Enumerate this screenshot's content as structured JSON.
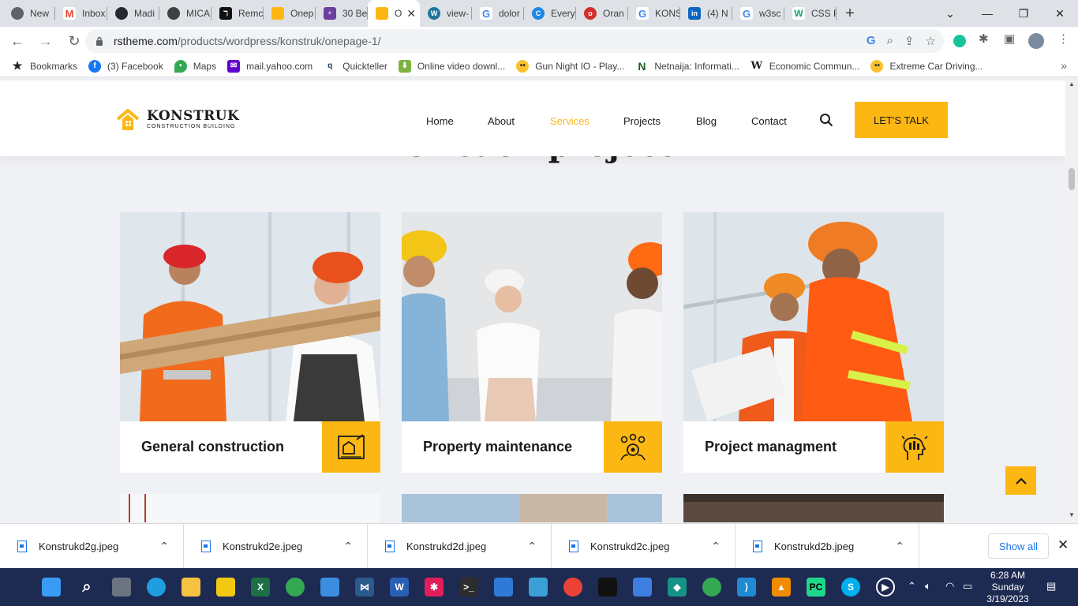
{
  "browser": {
    "tabs": [
      {
        "label": "New",
        "color": "#5f6368"
      },
      {
        "label": "Inbox",
        "color": "#ea4335"
      },
      {
        "label": "Madi",
        "color": "#24292f"
      },
      {
        "label": "MICA",
        "color": "#3c4043"
      },
      {
        "label": "Remc",
        "color": "#111111"
      },
      {
        "label": "Onep",
        "color": "#fdb713"
      },
      {
        "label": "30 Be",
        "color": "#6b3fa0"
      },
      {
        "label": "O",
        "color": "#fdb713",
        "active": true
      },
      {
        "label": "view-",
        "color": "#21759b"
      },
      {
        "label": "dolor",
        "color": "#4285f4"
      },
      {
        "label": "Every",
        "color": "#1e88e5"
      },
      {
        "label": "Oran",
        "color": "#d32f2f"
      },
      {
        "label": "KONS",
        "color": "#4285f4"
      },
      {
        "label": "(4) N",
        "color": "#0a66c2"
      },
      {
        "label": "w3sc",
        "color": "#4285f4"
      },
      {
        "label": "CSS F",
        "color": "#04aa6d"
      }
    ],
    "url_host": "rstheme.com",
    "url_path": "/products/wordpress/konstruk/onepage-1/",
    "bookmarks": [
      {
        "label": "Bookmarks",
        "color": "#202124"
      },
      {
        "label": "(3) Facebook",
        "color": "#1877f2"
      },
      {
        "label": "Maps",
        "color": "#34a853"
      },
      {
        "label": "mail.yahoo.com",
        "color": "#6001d2"
      },
      {
        "label": "Quickteller",
        "color": "#1b3a5c"
      },
      {
        "label": "Online video downl...",
        "color": "#7cb342"
      },
      {
        "label": "Gun Night IO - Play...",
        "color": "#fbc02d"
      },
      {
        "label": "Netnaija: Informati...",
        "color": "#1b5e20"
      },
      {
        "label": "Economic Commun...",
        "color": "#202124"
      },
      {
        "label": "Extreme Car Driving...",
        "color": "#fbc02d"
      }
    ]
  },
  "site": {
    "logo_name": "KONSTRUK",
    "logo_tag": "CONSTRUCTION BUILDING",
    "nav": [
      "Home",
      "About",
      "Services",
      "Projects",
      "Blog",
      "Contact"
    ],
    "nav_active": "Services",
    "cta": "LET'S TALK",
    "section_title": "for each project",
    "services": [
      {
        "title": "General construction",
        "icon": "blueprint-icon"
      },
      {
        "title": "Property maintenance",
        "icon": "team-gear-icon"
      },
      {
        "title": "Project managment",
        "icon": "head-tools-icon"
      }
    ]
  },
  "downloads": {
    "files": [
      "Konstrukd2g.jpeg",
      "Konstrukd2e.jpeg",
      "Konstrukd2d.jpeg",
      "Konstrukd2c.jpeg",
      "Konstrukd2b.jpeg"
    ],
    "show_all": "Show all"
  },
  "taskbar": {
    "time": "6:28 AM",
    "day": "Sunday",
    "date": "3/19/2023"
  },
  "colors": {
    "accent": "#fdb713",
    "taskbar": "#1d2a52"
  }
}
